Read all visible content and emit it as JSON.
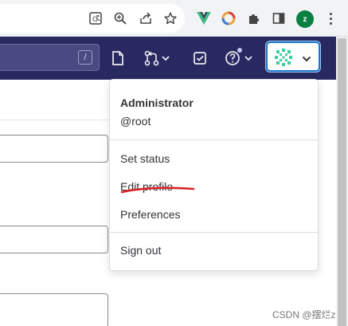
{
  "browser": {
    "icons": [
      "translate-icon",
      "zoom-icon",
      "share-icon",
      "star-icon",
      "vue-extension-icon",
      "color-extension-icon",
      "puzzle-icon",
      "side-panel-icon",
      "profile-icon",
      "more-icon"
    ],
    "profile_initial": "z"
  },
  "navbar": {
    "search_shortcut": "/",
    "icons": [
      "issues-icon",
      "merge-request-icon",
      "todo-icon",
      "help-icon",
      "user-avatar-icon"
    ]
  },
  "user_menu": {
    "name": "Administrator",
    "username": "@root",
    "items": [
      "Set status",
      "Edit profile",
      "Preferences",
      "Sign out"
    ]
  },
  "annotation": {
    "color": "#d9252a"
  },
  "watermark": "CSDN @摆烂z"
}
